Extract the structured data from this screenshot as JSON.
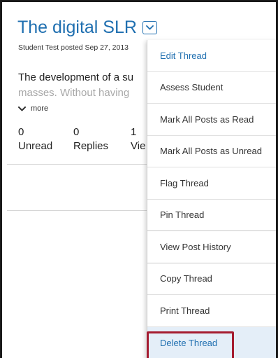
{
  "thread": {
    "title": "The digital SLR",
    "byline": "Student Test posted Sep 27, 2013",
    "body_line1": "The development of a su",
    "body_line2": "masses. Without having",
    "more_label": "more"
  },
  "stats": [
    {
      "value": "0",
      "label": "Unread"
    },
    {
      "value": "0",
      "label": "Replies"
    },
    {
      "value": "1",
      "label": "Vie"
    }
  ],
  "menu": {
    "items": [
      {
        "label": "Edit Thread"
      },
      {
        "label": "Assess Student"
      },
      {
        "label": "Mark All Posts as Read"
      },
      {
        "label": "Mark All Posts as Unread"
      },
      {
        "label": "Flag Thread"
      },
      {
        "label": "Pin Thread"
      },
      {
        "label": "View Post History"
      },
      {
        "label": "Copy Thread"
      },
      {
        "label": "Print Thread"
      },
      {
        "label": "Delete Thread"
      }
    ]
  },
  "icons": {
    "dropdown": "chevron-down-icon",
    "more": "chevron-down-icon"
  },
  "colors": {
    "link_blue": "#1f6fb0",
    "highlight_red": "#a51c30",
    "active_bg": "#e4eef8"
  }
}
